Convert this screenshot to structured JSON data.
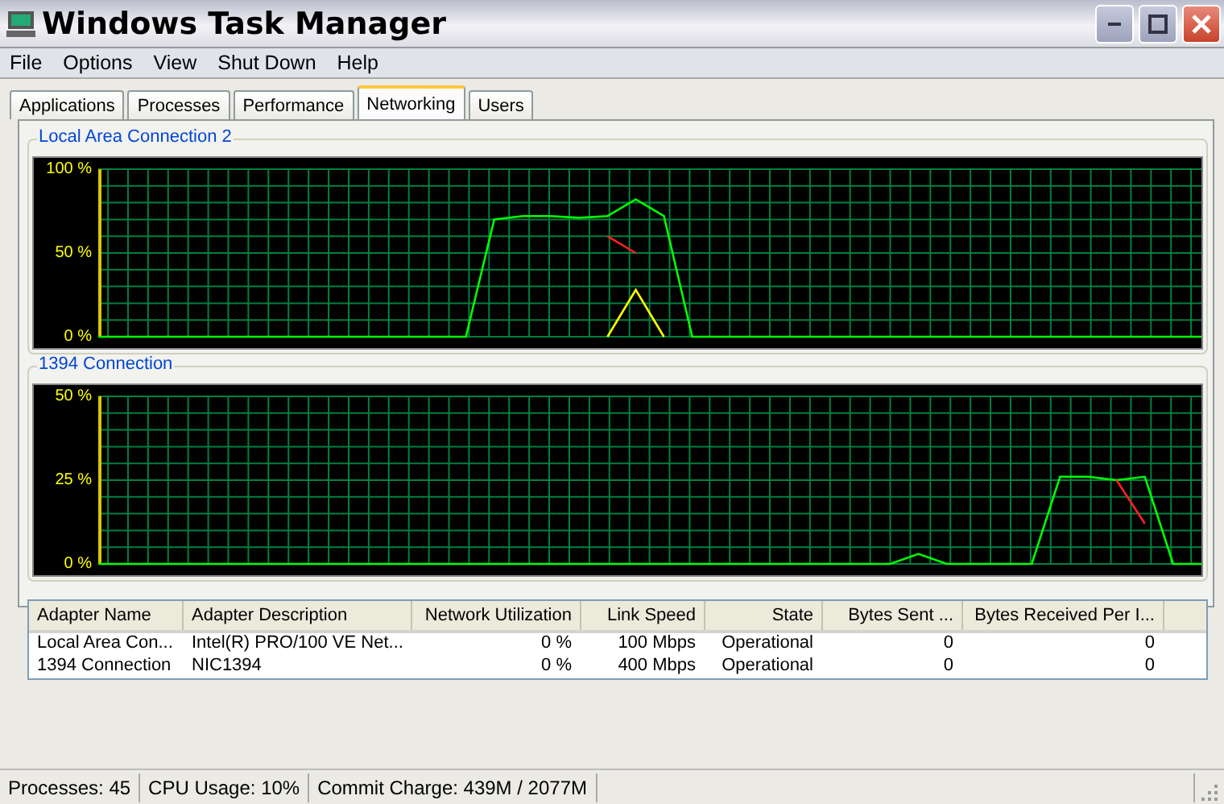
{
  "window": {
    "title": "Windows Task Manager"
  },
  "menu": [
    "File",
    "Options",
    "View",
    "Shut Down",
    "Help"
  ],
  "tabs": [
    {
      "label": "Applications",
      "selected": false
    },
    {
      "label": "Processes",
      "selected": false
    },
    {
      "label": "Performance",
      "selected": false
    },
    {
      "label": "Networking",
      "selected": true
    },
    {
      "label": "Users",
      "selected": false
    }
  ],
  "connections": [
    {
      "name": "Local Area Connection 2",
      "chart_data": {
        "type": "line",
        "grid": true,
        "ylim": [
          0,
          100
        ],
        "yticks": [
          {
            "value": 100,
            "label": "100 %"
          },
          {
            "value": 50,
            "label": "50 %"
          },
          {
            "value": 0,
            "label": "0 %"
          }
        ],
        "series": [
          {
            "color": "#00ff00",
            "values": [
              0,
              0,
              0,
              0,
              0,
              0,
              0,
              0,
              0,
              0,
              0,
              0,
              0,
              0,
              70,
              72,
              72,
              71,
              72,
              82,
              72,
              0,
              0,
              0,
              0,
              0,
              0,
              0,
              0,
              0,
              0,
              0,
              0,
              0,
              0,
              0,
              0,
              0,
              0,
              0
            ]
          },
          {
            "color": "#ffff00",
            "values": [
              null,
              null,
              null,
              null,
              null,
              null,
              null,
              null,
              null,
              null,
              null,
              null,
              null,
              null,
              null,
              null,
              null,
              null,
              0,
              28,
              0,
              null,
              null,
              null,
              null,
              null,
              null,
              null,
              null,
              null,
              null,
              null,
              null,
              null,
              null,
              null,
              null,
              null,
              null,
              null
            ]
          },
          {
            "color": "#ff2020",
            "values": [
              null,
              null,
              null,
              null,
              null,
              null,
              null,
              null,
              null,
              null,
              null,
              null,
              null,
              null,
              null,
              null,
              null,
              null,
              60,
              50,
              null,
              null,
              null,
              null,
              null,
              null,
              null,
              null,
              null,
              null,
              null,
              null,
              null,
              null,
              null,
              null,
              null,
              null,
              null,
              null
            ]
          }
        ]
      }
    },
    {
      "name": "1394 Connection",
      "chart_data": {
        "type": "line",
        "grid": true,
        "ylim": [
          0,
          50
        ],
        "yticks": [
          {
            "value": 50,
            "label": "50 %"
          },
          {
            "value": 25,
            "label": "25 %"
          },
          {
            "value": 0,
            "label": "0 %"
          }
        ],
        "series": [
          {
            "color": "#00ff00",
            "values": [
              0,
              0,
              0,
              0,
              0,
              0,
              0,
              0,
              0,
              0,
              0,
              0,
              0,
              0,
              0,
              0,
              0,
              0,
              0,
              0,
              0,
              0,
              0,
              0,
              0,
              0,
              0,
              0,
              0,
              3,
              0,
              0,
              0,
              0,
              26,
              26,
              25,
              26,
              0,
              0
            ]
          },
          {
            "color": "#ff2020",
            "values": [
              null,
              null,
              null,
              null,
              null,
              null,
              null,
              null,
              null,
              null,
              null,
              null,
              null,
              null,
              null,
              null,
              null,
              null,
              null,
              null,
              null,
              null,
              null,
              null,
              null,
              null,
              null,
              null,
              null,
              null,
              null,
              null,
              null,
              null,
              null,
              null,
              25,
              12,
              null,
              null
            ]
          }
        ]
      }
    }
  ],
  "table": {
    "columns": [
      "Adapter Name",
      "Adapter Description",
      "Network Utilization",
      "Link Speed",
      "State",
      "Bytes Sent ...",
      "Bytes Received Per I..."
    ],
    "rows": [
      [
        "Local Area Con...",
        "Intel(R) PRO/100 VE Net...",
        "0 %",
        "100 Mbps",
        "Operational",
        "0",
        "0"
      ],
      [
        "1394 Connection",
        "NIC1394",
        "0 %",
        "400 Mbps",
        "Operational",
        "0",
        "0"
      ]
    ]
  },
  "status_bar": [
    "Processes: 45",
    "CPU Usage: 10%",
    "Commit Charge: 439M / 2077M"
  ]
}
